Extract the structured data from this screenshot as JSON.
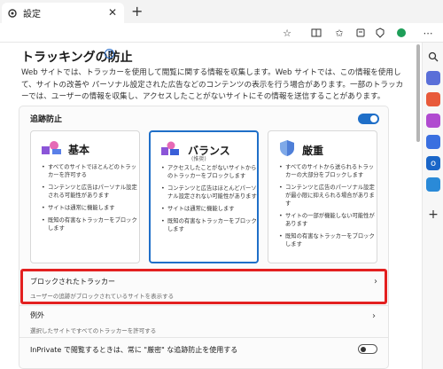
{
  "browser": {
    "tab_title": "設定",
    "tab_close": "✕",
    "new_tab": "+"
  },
  "page": {
    "title": "トラッキングの防止",
    "description": "Web サイトでは、トラッカーを使用して閲覧に関する情報を収集します。Web サイトでは、この情報を使用して、サイトの改善や パーソナル設定された広告などのコンテンツの表示を行う場合があります。一部のトラッカーでは、ユーザーの情報を収集し、アクセスしたことがないサイトにその情報を送信することがあります。"
  },
  "tracking_prevention": {
    "label": "追跡防止",
    "enabled": true,
    "levels": [
      {
        "title": "基本",
        "subtitle": "",
        "selected": false,
        "bullets": [
          "すべてのサイトでほとんどのトラッカーを許可する",
          "コンテンツと広告はパーソナル設定される可能性があります",
          "サイトは通常に機能します",
          "既知の有害なトラッカーをブロックします"
        ]
      },
      {
        "title": "バランス",
        "subtitle": "(推奨)",
        "selected": true,
        "bullets": [
          "アクセスしたことがないサイトからのトラッカーをブロックします",
          "コンテンツと広告はほとんどパーソナル設定されない可能性があります",
          "サイトは通常に機能します",
          "既知の有害なトラッカーをブロックします"
        ]
      },
      {
        "title": "厳重",
        "subtitle": "",
        "selected": false,
        "bullets": [
          "すべてのサイトから送られるトラッカーの大部分をブロックします",
          "コンテンツと広告のパーソナル設定が最小限に抑えられる場合があります",
          "サイトの一部が機能しない可能性があります",
          "既知の有害なトラッカーをブロックします"
        ]
      }
    ]
  },
  "blocked_trackers": {
    "title": "ブロックされたトラッカー",
    "subtitle": "ユーザーの追跡がブロックされているサイトを表示する"
  },
  "exceptions": {
    "title": "例外",
    "subtitle": "選択したサイトですべてのトラッカーを許可する"
  },
  "inprivate": {
    "label": "InPrivate で閲覧するときは、常に \"厳密\" な追跡防止を使用する",
    "enabled": false
  },
  "colors": {
    "accent": "#1f6fc8",
    "highlight_border": "#e32020"
  }
}
